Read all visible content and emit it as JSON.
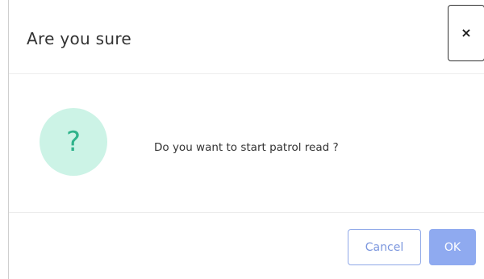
{
  "dialog": {
    "title": "Are you sure",
    "close_label": "×",
    "message": "Do you want to start patrol read ?",
    "icon": {
      "name": "question-icon",
      "glyph": "?",
      "circle_color": "#ccf3e6",
      "glyph_color": "#2fb38b"
    }
  },
  "footer": {
    "cancel_label": "Cancel",
    "ok_label": "OK"
  },
  "colors": {
    "primary": "#8faaf0",
    "cancel_border": "#8fa8e8",
    "text": "#333333"
  }
}
